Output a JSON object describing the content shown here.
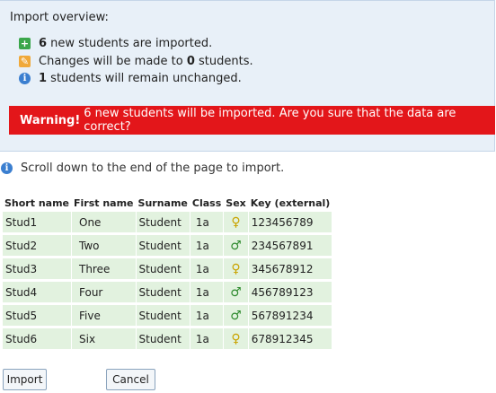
{
  "overview": {
    "title": "Import overview:",
    "lines": [
      {
        "icon": "plus-icon",
        "count": "6",
        "text": " new students are imported."
      },
      {
        "icon": "pencil-icon",
        "prefix": "Changes will be made to ",
        "count": "0",
        "text": " students."
      },
      {
        "icon": "info-icon",
        "count": "1",
        "text": " students will remain unchanged."
      }
    ],
    "warning": {
      "label": "Warning!",
      "text": "6 new students will be imported. Are you sure that the data are correct?"
    }
  },
  "scroll_note": "Scroll down to the end of the page to import.",
  "table": {
    "headers": [
      "Short name",
      "First name",
      "Surname",
      "Class",
      "Sex",
      "Key (external)"
    ],
    "rows": [
      {
        "short": "Stud1",
        "first": "One",
        "surname": "Student",
        "class": "1a",
        "sex": "female",
        "key": "123456789"
      },
      {
        "short": "Stud2",
        "first": "Two",
        "surname": "Student",
        "class": "1a",
        "sex": "male",
        "key": "234567891"
      },
      {
        "short": "Stud3",
        "first": "Three",
        "surname": "Student",
        "class": "1a",
        "sex": "female",
        "key": "345678912"
      },
      {
        "short": "Stud4",
        "first": "Four",
        "surname": "Student",
        "class": "1a",
        "sex": "male",
        "key": "456789123"
      },
      {
        "short": "Stud5",
        "first": "Five",
        "surname": "Student",
        "class": "1a",
        "sex": "male",
        "key": "567891234"
      },
      {
        "short": "Stud6",
        "first": "Six",
        "surname": "Student",
        "class": "1a",
        "sex": "female",
        "key": "678912345"
      }
    ]
  },
  "buttons": {
    "import": "Import",
    "cancel": "Cancel"
  },
  "colors": {
    "warning_bg": "#e3161a",
    "row_bg": "#e2f2df",
    "overview_bg": "#e8f0f8"
  }
}
